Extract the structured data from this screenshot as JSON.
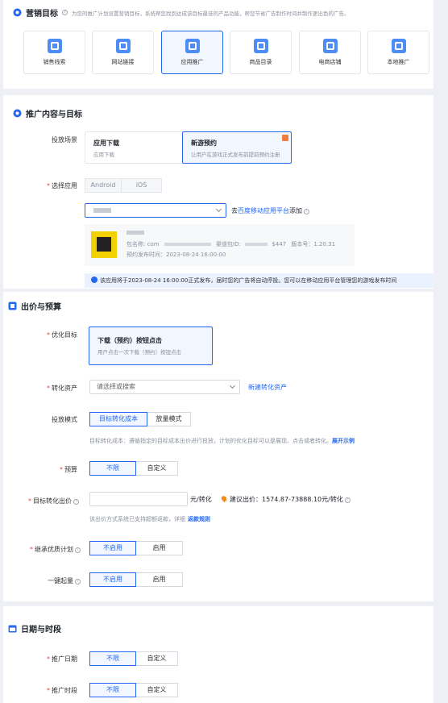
{
  "marketing_goal": {
    "title": "营销目标",
    "description": "为您的推广计划设置营销目标，系统帮您找到达成该目标最佳的产品功能，帮您节省广告制作时间并制作更出色的广告。",
    "tiles": [
      {
        "label": "销售线索",
        "icon": "sales-lead-icon"
      },
      {
        "label": "网站链接",
        "icon": "website-link-icon"
      },
      {
        "label": "应用推广",
        "icon": "app-promotion-icon",
        "active": true
      },
      {
        "label": "商品目录",
        "icon": "product-catalog-icon"
      },
      {
        "label": "电商店铺",
        "icon": "shop-cart-icon"
      },
      {
        "label": "本地推广",
        "icon": "local-promotion-icon"
      }
    ]
  },
  "promo_content": {
    "title": "推广内容与目标",
    "scene_label": "投放场景",
    "scene_options": [
      {
        "title": "应用下载",
        "desc": "应用下载"
      },
      {
        "title": "新游预约",
        "desc": "让用户在游戏正式发布前提前预约注册",
        "active": true
      }
    ],
    "app_label": "选择应用",
    "platform_tabs": [
      "Android",
      "iOS"
    ],
    "app_select_value": "",
    "add_link_prefix": "去",
    "add_link": "百度移动应用平台",
    "add_link_suffix": "添加",
    "app_info": {
      "package_label": "包名称: com",
      "channel_label": "渠道包ID:",
      "channel_tail": "$447",
      "version_label": "版本号：1.20.31",
      "release_label": "预约发布时间：2023-08-24 16:00:00"
    },
    "notice": "该应用将于2023-08-24 16:00:00正式发布，届时您的广告将自动停投。您可以在移动应用平台管理您的游戏发布时间"
  },
  "bid_budget": {
    "title": "出价与预算",
    "opt_target_label": "优化目标",
    "opt_target": {
      "title": "下载（预约）按钮点击",
      "desc": "用户点击一次下载（预约）按钮点击"
    },
    "convert_asset_label": "转化资产",
    "convert_asset_placeholder": "请选择或搜索",
    "new_asset_link": "新建转化资产",
    "mode_label": "投放模式",
    "mode_options": [
      "目标转化成本",
      "放量模式"
    ],
    "mode_desc": "目标转化成本：遵循指定的目标成本出价进行投放，计划的优化目标可以是展现、点击或者转化。",
    "mode_desc_link": "展开示例",
    "budget_label": "预算",
    "budget_options": [
      "不限",
      "自定义"
    ],
    "target_bid_label": "目标转化出价",
    "target_bid_unit": "元/转化",
    "suggest_bid": "建议出价：1574.87-73888.10元/转化",
    "refund_desc": "该出价方式系统已支持超额返款，详细",
    "refund_link": "返款规则",
    "inherit_label": "继承优质计划",
    "inherit_options": [
      "不启用",
      "启用"
    ],
    "quick_start_label": "一键起量",
    "quick_start_options": [
      "不启用",
      "启用"
    ]
  },
  "schedule": {
    "title": "日期与时段",
    "date_label": "推广日期",
    "date_options": [
      "不限",
      "自定义"
    ],
    "time_label": "推广时段",
    "time_options": [
      "不限",
      "自定义"
    ]
  },
  "colors": {
    "accent": "#2468f2",
    "required": "#e8473f"
  }
}
